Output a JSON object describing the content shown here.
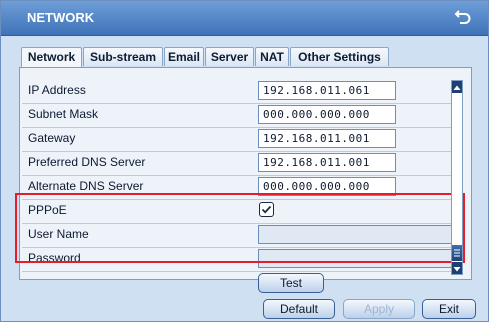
{
  "window": {
    "title": "NETWORK"
  },
  "tabs": [
    {
      "label": "Network",
      "active": true
    },
    {
      "label": "Sub-stream",
      "active": false
    },
    {
      "label": "Email",
      "active": false
    },
    {
      "label": "Server",
      "active": false
    },
    {
      "label": "NAT",
      "active": false
    },
    {
      "label": "Other Settings",
      "active": false
    }
  ],
  "fields": [
    {
      "label": "IP Address",
      "value": "192.168.011.061"
    },
    {
      "label": "Subnet Mask",
      "value": "000.000.000.000"
    },
    {
      "label": "Gateway",
      "value": "192.168.011.001"
    },
    {
      "label": "Preferred DNS Server",
      "value": "192.168.011.001"
    },
    {
      "label": "Alternate DNS Server",
      "value": "000.000.000.000"
    }
  ],
  "pppoe": {
    "label": "PPPoE",
    "checked": true,
    "username_label": "User Name",
    "username_value": "",
    "password_label": "Password",
    "password_value": ""
  },
  "test_button": "Test",
  "footer": {
    "default_label": "Default",
    "apply_label": "Apply",
    "exit_label": "Exit"
  },
  "icons": {
    "back": "back-arrow-icon",
    "checkbox": "checkmark-icon"
  },
  "colors": {
    "highlight": "#e21d2c",
    "title_bar": "#4a7fc2"
  }
}
